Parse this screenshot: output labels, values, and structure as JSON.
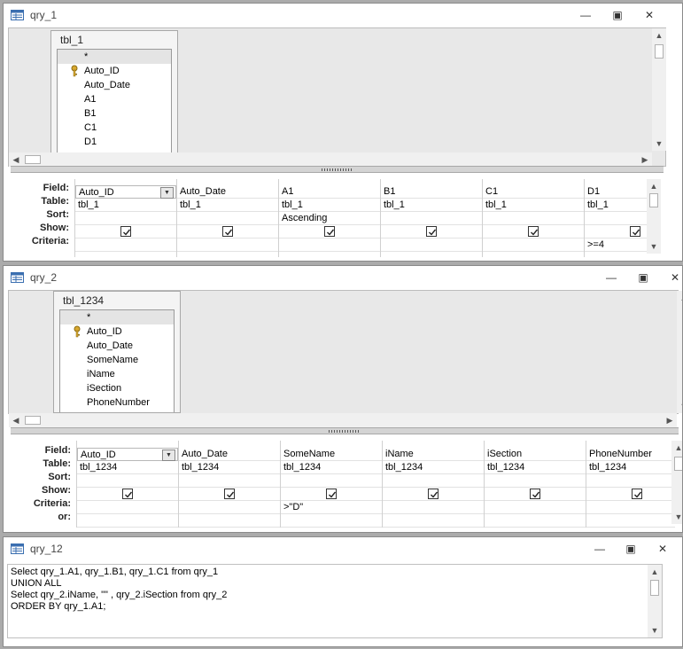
{
  "qry1": {
    "title": "qry_1",
    "table": {
      "name": "tbl_1",
      "star": "*",
      "fields": [
        "Auto_ID",
        "Auto_Date",
        "A1",
        "B1",
        "C1",
        "D1"
      ]
    },
    "grid": {
      "row_labels": [
        "Field:",
        "Table:",
        "Sort:",
        "Show:",
        "Criteria:"
      ],
      "columns": [
        {
          "field": "Auto_ID",
          "table": "tbl_1",
          "sort": "",
          "show": true,
          "criteria": ""
        },
        {
          "field": "Auto_Date",
          "table": "tbl_1",
          "sort": "",
          "show": true,
          "criteria": ""
        },
        {
          "field": "A1",
          "table": "tbl_1",
          "sort": "Ascending",
          "show": true,
          "criteria": ""
        },
        {
          "field": "B1",
          "table": "tbl_1",
          "sort": "",
          "show": true,
          "criteria": ""
        },
        {
          "field": "C1",
          "table": "tbl_1",
          "sort": "",
          "show": true,
          "criteria": ""
        },
        {
          "field": "D1",
          "table": "tbl_1",
          "sort": "",
          "show": true,
          "criteria": ">=4"
        }
      ]
    }
  },
  "qry2": {
    "title": "qry_2",
    "table": {
      "name": "tbl_1234",
      "star": "*",
      "fields": [
        "Auto_ID",
        "Auto_Date",
        "SomeName",
        "iName",
        "iSection",
        "PhoneNumber"
      ]
    },
    "grid": {
      "row_labels": [
        "Field:",
        "Table:",
        "Sort:",
        "Show:",
        "Criteria:",
        "or:"
      ],
      "columns": [
        {
          "field": "Auto_ID",
          "table": "tbl_1234",
          "sort": "",
          "show": true,
          "criteria": ""
        },
        {
          "field": "Auto_Date",
          "table": "tbl_1234",
          "sort": "",
          "show": true,
          "criteria": ""
        },
        {
          "field": "SomeName",
          "table": "tbl_1234",
          "sort": "",
          "show": true,
          "criteria": ">\"D\""
        },
        {
          "field": "iName",
          "table": "tbl_1234",
          "sort": "",
          "show": true,
          "criteria": ""
        },
        {
          "field": "iSection",
          "table": "tbl_1234",
          "sort": "",
          "show": true,
          "criteria": ""
        },
        {
          "field": "PhoneNumber",
          "table": "tbl_1234",
          "sort": "",
          "show": true,
          "criteria": ""
        }
      ]
    }
  },
  "qry12": {
    "title": "qry_12",
    "sql_lines": [
      "Select qry_1.A1, qry_1.B1, qry_1.C1 from qry_1",
      "UNION ALL",
      "Select qry_2.iName, \"\" , qry_2.iSection from qry_2",
      "ORDER BY qry_1.A1;"
    ]
  },
  "window_buttons": {
    "minimize": "—",
    "restore": "▣",
    "close": "✕"
  },
  "icons": {
    "minimize": "minimize-icon",
    "restore": "restore-icon",
    "close": "close-icon",
    "key": "primary-key-icon",
    "app": "query-icon"
  }
}
